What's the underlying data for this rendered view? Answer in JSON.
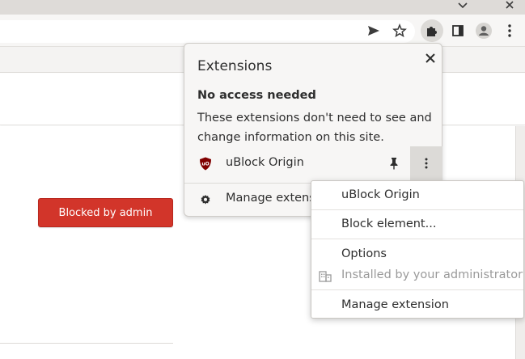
{
  "extensions_popup": {
    "title": "Extensions",
    "section_heading": "No access needed",
    "section_description": "These extensions don't need to see and change information on this site.",
    "extension_name": "uBlock Origin",
    "manage_label": "Manage extensions"
  },
  "context_menu": {
    "items": [
      {
        "label": "uBlock Origin"
      },
      {
        "label": "Block element..."
      },
      {
        "label": "Options"
      },
      {
        "label": "Installed by your administrator"
      },
      {
        "label": "Manage extension"
      }
    ]
  },
  "page": {
    "blocked_button_label": "Blocked by admin"
  },
  "colors": {
    "accent_red": "#d2352a",
    "ublock_red": "#800000",
    "toolbar_bg": "#f7f6f5",
    "popup_bg": "#f7f6f5"
  },
  "icons": [
    "chevron-down-icon",
    "close-icon",
    "send-icon",
    "star-icon",
    "puzzle-icon",
    "side-panel-icon",
    "profile-icon",
    "more-vert-icon",
    "gear-icon",
    "pin-icon",
    "ublock-icon",
    "building-icon"
  ]
}
